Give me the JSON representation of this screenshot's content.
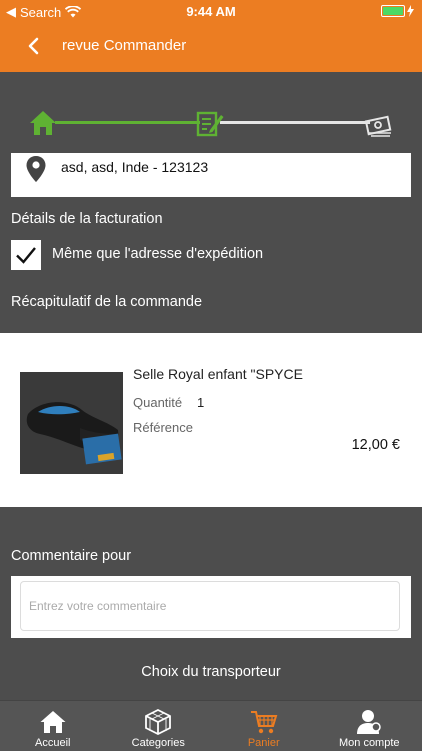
{
  "status_bar": {
    "carrier": "Search",
    "time": "9:44 AM"
  },
  "nav": {
    "title": "revue Commander"
  },
  "colors": {
    "accent": "#ec7d22",
    "progress_done": "#5fb233",
    "background": "#4d4d4d"
  },
  "steps": {
    "icons": [
      "home-icon",
      "edit-icon",
      "payment-icon"
    ]
  },
  "address": {
    "text": "asd, asd, Inde - 123123"
  },
  "billing": {
    "heading": "Détails de la facturation",
    "same_as_shipping_label": "Même que l'adresse d'expédition",
    "same_as_shipping_checked": true
  },
  "summary": {
    "heading": "Récapitulatif de la commande"
  },
  "product": {
    "name": "Selle Royal enfant \"SPYCE",
    "quantity_label": "Quantité",
    "quantity": "1",
    "reference_label": "Référence",
    "price": "12,00 €"
  },
  "comment": {
    "heading": "Commentaire pour",
    "placeholder": "Entrez votre commentaire"
  },
  "carrier_choice": {
    "heading": "Choix du transporteur"
  },
  "tabs": [
    {
      "label": "Accueil",
      "icon": "home-icon"
    },
    {
      "label": "Categories",
      "icon": "cube-icon"
    },
    {
      "label": "Panier",
      "icon": "cart-icon",
      "active": true
    },
    {
      "label": "Mon compte",
      "icon": "user-icon"
    }
  ]
}
